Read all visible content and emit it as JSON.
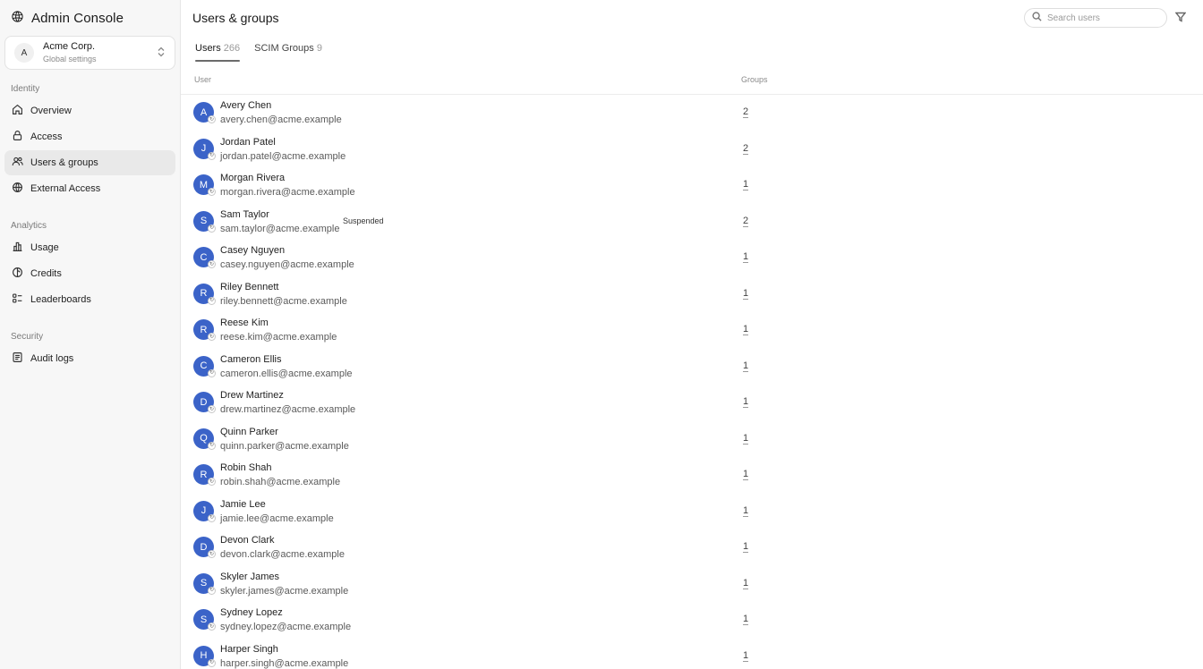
{
  "app": {
    "title": "Admin Console"
  },
  "org": {
    "avatar": "A",
    "name": "Acme Corp.",
    "subtitle": "Global settings"
  },
  "sidebar": {
    "sections": [
      {
        "label": "Identity",
        "items": [
          {
            "label": "Overview",
            "icon": "home-icon"
          },
          {
            "label": "Access",
            "icon": "lock-icon"
          },
          {
            "label": "Users & groups",
            "icon": "users-icon",
            "active": true
          },
          {
            "label": "External Access",
            "icon": "globe-icon"
          }
        ]
      },
      {
        "label": "Analytics",
        "items": [
          {
            "label": "Usage",
            "icon": "bar-chart-icon"
          },
          {
            "label": "Credits",
            "icon": "credits-icon"
          },
          {
            "label": "Leaderboards",
            "icon": "leaderboard-icon"
          }
        ]
      },
      {
        "label": "Security",
        "items": [
          {
            "label": "Audit logs",
            "icon": "audit-log-icon"
          }
        ]
      }
    ]
  },
  "header": {
    "title": "Users & groups",
    "search_placeholder": "Search users"
  },
  "tabs": [
    {
      "label": "Users",
      "count": "266",
      "active": true
    },
    {
      "label": "SCIM Groups",
      "count": "9",
      "active": false
    }
  ],
  "table": {
    "columns": {
      "user": "User",
      "groups": "Groups"
    },
    "rows": [
      {
        "initial": "A",
        "name": "Avery Chen",
        "email": "avery.chen@acme.example",
        "status": "",
        "groups": "2"
      },
      {
        "initial": "J",
        "name": "Jordan Patel",
        "email": "jordan.patel@acme.example",
        "status": "",
        "groups": "2"
      },
      {
        "initial": "M",
        "name": "Morgan Rivera",
        "email": "morgan.rivera@acme.example",
        "status": "",
        "groups": "1"
      },
      {
        "initial": "S",
        "name": "Sam Taylor",
        "email": "sam.taylor@acme.example",
        "status": "Suspended",
        "groups": "2"
      },
      {
        "initial": "C",
        "name": "Casey Nguyen",
        "email": "casey.nguyen@acme.example",
        "status": "",
        "groups": "1"
      },
      {
        "initial": "R",
        "name": "Riley Bennett",
        "email": "riley.bennett@acme.example",
        "status": "",
        "groups": "1"
      },
      {
        "initial": "R",
        "name": "Reese Kim",
        "email": "reese.kim@acme.example",
        "status": "",
        "groups": "1"
      },
      {
        "initial": "C",
        "name": "Cameron Ellis",
        "email": "cameron.ellis@acme.example",
        "status": "",
        "groups": "1"
      },
      {
        "initial": "D",
        "name": "Drew Martinez",
        "email": "drew.martinez@acme.example",
        "status": "",
        "groups": "1"
      },
      {
        "initial": "Q",
        "name": "Quinn Parker",
        "email": "quinn.parker@acme.example",
        "status": "",
        "groups": "1"
      },
      {
        "initial": "R",
        "name": "Robin Shah",
        "email": "robin.shah@acme.example",
        "status": "",
        "groups": "1"
      },
      {
        "initial": "J",
        "name": "Jamie Lee",
        "email": "jamie.lee@acme.example",
        "status": "",
        "groups": "1"
      },
      {
        "initial": "D",
        "name": "Devon Clark",
        "email": "devon.clark@acme.example",
        "status": "",
        "groups": "1"
      },
      {
        "initial": "S",
        "name": "Skyler James",
        "email": "skyler.james@acme.example",
        "status": "",
        "groups": "1"
      },
      {
        "initial": "S",
        "name": "Sydney Lopez",
        "email": "sydney.lopez@acme.example",
        "status": "",
        "groups": "1"
      },
      {
        "initial": "H",
        "name": "Harper Singh",
        "email": "harper.singh@acme.example",
        "status": "",
        "groups": "1"
      }
    ]
  },
  "colors": {
    "avatar": "#3b63c8",
    "active_nav": "#e9e9e9",
    "sidebar_bg": "#f7f7f7"
  }
}
